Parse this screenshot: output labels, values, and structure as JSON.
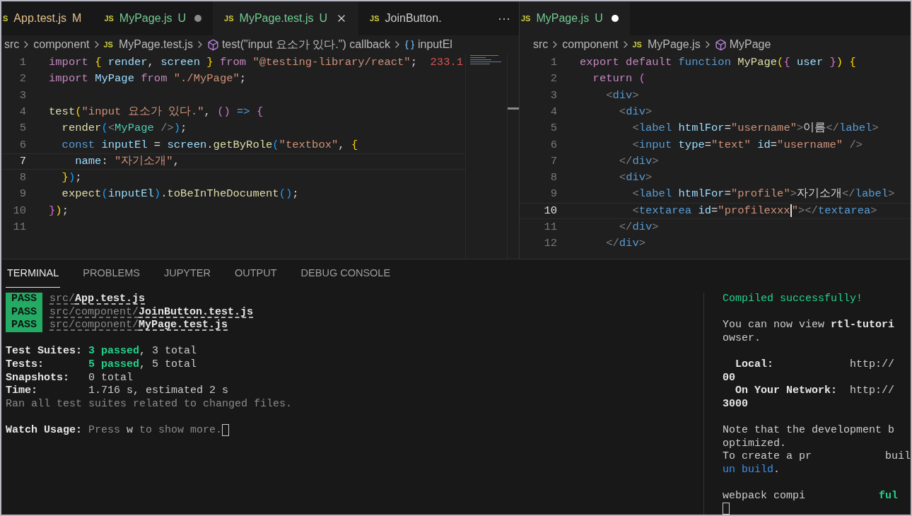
{
  "left_editor": {
    "tabs": [
      {
        "icon": "S",
        "label": "App.test.js",
        "status": "M",
        "kind": "modified",
        "dirty": false,
        "selected": false
      },
      {
        "icon": "JS",
        "label": "MyPage.js",
        "status": "U",
        "kind": "untracked",
        "dirty": true,
        "selected": false
      },
      {
        "icon": "JS",
        "label": "MyPage.test.js",
        "status": "U",
        "kind": "untracked",
        "dirty": false,
        "selected": true
      },
      {
        "icon": "JS",
        "label": "JoinButton.",
        "kind": "plain",
        "dirty": false,
        "selected": false
      }
    ],
    "more": "···",
    "breadcrumb": [
      {
        "kind": "folder",
        "text": "src"
      },
      {
        "kind": "folder",
        "text": "component"
      },
      {
        "kind": "file",
        "icon": "JS",
        "text": "MyPage.test.js"
      },
      {
        "kind": "function",
        "text": "test(\"input 요소가 있다.\") callback"
      },
      {
        "kind": "variable",
        "text": "inputEl"
      }
    ],
    "lines": [
      {
        "number": "1",
        "current": false,
        "tokens": [
          {
            "kind": "keyword",
            "text": "import "
          },
          {
            "kind": "brace1",
            "text": "{ "
          },
          {
            "kind": "variable",
            "text": "render"
          },
          {
            "kind": "punct",
            "text": ", "
          },
          {
            "kind": "variable",
            "text": "screen "
          },
          {
            "kind": "brace1",
            "text": "} "
          },
          {
            "kind": "keyword",
            "text": "from "
          },
          {
            "kind": "string",
            "text": "\"@testing-library/react\""
          },
          {
            "kind": "punct",
            "text": ";  "
          },
          {
            "kind": "hint",
            "text": "233.1"
          }
        ]
      },
      {
        "number": "2",
        "current": false,
        "tokens": [
          {
            "kind": "keyword",
            "text": "import "
          },
          {
            "kind": "variable",
            "text": "MyPage "
          },
          {
            "kind": "keyword",
            "text": "from "
          },
          {
            "kind": "string",
            "text": "\"./MyPage\""
          },
          {
            "kind": "punct",
            "text": ";"
          }
        ]
      },
      {
        "number": "3",
        "current": false
      },
      {
        "number": "4",
        "current": false,
        "tokens": [
          {
            "kind": "function",
            "text": "test"
          },
          {
            "kind": "brace1",
            "text": "("
          },
          {
            "kind": "string",
            "text": "\"input 요소가 있다.\""
          },
          {
            "kind": "punct",
            "text": ", "
          },
          {
            "kind": "brace2",
            "text": "() "
          },
          {
            "kind": "storage",
            "text": "=> "
          },
          {
            "kind": "brace2",
            "text": "{"
          }
        ]
      },
      {
        "number": "5",
        "current": false,
        "tokens": [
          {
            "kind": "function",
            "text": "  render"
          },
          {
            "kind": "brace3",
            "text": "("
          },
          {
            "kind": "tag-bracket",
            "text": "<"
          },
          {
            "kind": "component",
            "text": "MyPage"
          },
          {
            "kind": "tag-bracket",
            "text": " />"
          },
          {
            "kind": "brace3",
            "text": ")"
          },
          {
            "kind": "punct",
            "text": ";"
          }
        ]
      },
      {
        "number": "6",
        "current": false,
        "tokens": [
          {
            "kind": "storage",
            "text": "  const "
          },
          {
            "kind": "variable",
            "text": "inputEl"
          },
          {
            "kind": "punct",
            "text": " = "
          },
          {
            "kind": "variable",
            "text": "screen"
          },
          {
            "kind": "punct",
            "text": "."
          },
          {
            "kind": "function",
            "text": "getByRole"
          },
          {
            "kind": "brace3",
            "text": "("
          },
          {
            "kind": "string",
            "text": "\"textbox\""
          },
          {
            "kind": "punct",
            "text": ", "
          },
          {
            "kind": "brace1",
            "text": "{"
          }
        ]
      },
      {
        "number": "7",
        "current": true,
        "tokens": [
          {
            "kind": "variable",
            "text": "    name"
          },
          {
            "kind": "punct",
            "text": ": "
          },
          {
            "kind": "string",
            "text": "\"자기소개\""
          },
          {
            "kind": "punct",
            "text": ","
          }
        ]
      },
      {
        "number": "8",
        "current": false,
        "tokens": [
          {
            "kind": "brace1",
            "text": "  }"
          },
          {
            "kind": "brace3",
            "text": ")"
          },
          {
            "kind": "punct",
            "text": ";"
          }
        ]
      },
      {
        "number": "9",
        "current": false,
        "tokens": [
          {
            "kind": "function",
            "text": "  expect"
          },
          {
            "kind": "brace3",
            "text": "("
          },
          {
            "kind": "variable",
            "text": "inputEl"
          },
          {
            "kind": "brace3",
            "text": ")"
          },
          {
            "kind": "punct",
            "text": "."
          },
          {
            "kind": "function",
            "text": "toBeInTheDocument"
          },
          {
            "kind": "brace3",
            "text": "()"
          },
          {
            "kind": "punct",
            "text": ";"
          }
        ]
      },
      {
        "number": "10",
        "current": false,
        "tokens": [
          {
            "kind": "brace2",
            "text": "}"
          },
          {
            "kind": "brace1",
            "text": ")"
          },
          {
            "kind": "punct",
            "text": ";"
          }
        ]
      },
      {
        "number": "11",
        "current": false
      }
    ]
  },
  "right_editor": {
    "tabs": [
      {
        "icon": "JS",
        "label": "MyPage.js",
        "status": "U",
        "kind": "untracked",
        "dirty": true,
        "selected": true
      }
    ],
    "breadcrumb": [
      {
        "kind": "folder",
        "text": "src"
      },
      {
        "kind": "folder",
        "text": "component"
      },
      {
        "kind": "file",
        "icon": "JS",
        "text": "MyPage.js"
      },
      {
        "kind": "function",
        "text": "MyPage"
      }
    ],
    "lines": [
      {
        "number": "1",
        "current": false,
        "tokens": [
          {
            "kind": "keyword",
            "text": "export default "
          },
          {
            "kind": "storage",
            "text": "function "
          },
          {
            "kind": "function",
            "text": "MyPage"
          },
          {
            "kind": "brace1",
            "text": "("
          },
          {
            "kind": "brace2",
            "text": "{"
          },
          {
            "kind": "variable",
            "text": " user "
          },
          {
            "kind": "brace2",
            "text": "}"
          },
          {
            "kind": "brace1",
            "text": ") "
          },
          {
            "kind": "brace1",
            "text": "{"
          }
        ]
      },
      {
        "number": "2",
        "current": false,
        "tokens": [
          {
            "kind": "keyword",
            "text": "  return "
          },
          {
            "kind": "brace2",
            "text": "("
          }
        ]
      },
      {
        "number": "3",
        "current": false,
        "tokens": [
          {
            "kind": "tag-bracket",
            "text": "    <"
          },
          {
            "kind": "tag",
            "text": "div"
          },
          {
            "kind": "tag-bracket",
            "text": ">"
          }
        ]
      },
      {
        "number": "4",
        "current": false,
        "tokens": [
          {
            "kind": "tag-bracket",
            "text": "      <"
          },
          {
            "kind": "tag",
            "text": "div"
          },
          {
            "kind": "tag-bracket",
            "text": ">"
          }
        ]
      },
      {
        "number": "5",
        "current": false,
        "tokens": [
          {
            "kind": "tag-bracket",
            "text": "        <"
          },
          {
            "kind": "tag",
            "text": "label "
          },
          {
            "kind": "variable",
            "text": "htmlFor"
          },
          {
            "kind": "punct",
            "text": "="
          },
          {
            "kind": "string",
            "text": "\"username\""
          },
          {
            "kind": "tag-bracket",
            "text": ">"
          },
          {
            "kind": "punct",
            "text": "이름"
          },
          {
            "kind": "tag-bracket",
            "text": "</"
          },
          {
            "kind": "tag",
            "text": "label"
          },
          {
            "kind": "tag-bracket",
            "text": ">"
          }
        ]
      },
      {
        "number": "6",
        "current": false,
        "tokens": [
          {
            "kind": "tag-bracket",
            "text": "        <"
          },
          {
            "kind": "tag",
            "text": "input "
          },
          {
            "kind": "variable",
            "text": "type"
          },
          {
            "kind": "punct",
            "text": "="
          },
          {
            "kind": "string",
            "text": "\"text\" "
          },
          {
            "kind": "variable",
            "text": "id"
          },
          {
            "kind": "punct",
            "text": "="
          },
          {
            "kind": "string",
            "text": "\"username\""
          },
          {
            "kind": "tag-bracket",
            "text": " />"
          }
        ]
      },
      {
        "number": "7",
        "current": false,
        "tokens": [
          {
            "kind": "tag-bracket",
            "text": "      </"
          },
          {
            "kind": "tag",
            "text": "div"
          },
          {
            "kind": "tag-bracket",
            "text": ">"
          }
        ]
      },
      {
        "number": "8",
        "current": false,
        "tokens": [
          {
            "kind": "tag-bracket",
            "text": "      <"
          },
          {
            "kind": "tag",
            "text": "div"
          },
          {
            "kind": "tag-bracket",
            "text": ">"
          }
        ]
      },
      {
        "number": "9",
        "current": false,
        "tokens": [
          {
            "kind": "tag-bracket",
            "text": "        <"
          },
          {
            "kind": "tag",
            "text": "label "
          },
          {
            "kind": "variable",
            "text": "htmlFor"
          },
          {
            "kind": "punct",
            "text": "="
          },
          {
            "kind": "string",
            "text": "\"profile\""
          },
          {
            "kind": "tag-bracket",
            "text": ">"
          },
          {
            "kind": "punct",
            "text": "자기소개"
          },
          {
            "kind": "tag-bracket",
            "text": "</"
          },
          {
            "kind": "tag",
            "text": "label"
          },
          {
            "kind": "tag-bracket",
            "text": ">"
          }
        ]
      },
      {
        "number": "10",
        "current": true,
        "tokens": [
          {
            "kind": "tag-bracket",
            "text": "        <"
          },
          {
            "kind": "tag",
            "text": "textarea "
          },
          {
            "kind": "variable",
            "text": "id"
          },
          {
            "kind": "punct",
            "text": "="
          },
          {
            "kind": "string",
            "text": "\"profilexxx"
          },
          {
            "kind": "cursor"
          },
          {
            "kind": "string",
            "text": "\""
          },
          {
            "kind": "tag-bracket",
            "text": "></"
          },
          {
            "kind": "tag",
            "text": "textarea"
          },
          {
            "kind": "tag-bracket",
            "text": ">"
          }
        ]
      },
      {
        "number": "11",
        "current": false,
        "tokens": [
          {
            "kind": "tag-bracket",
            "text": "      </"
          },
          {
            "kind": "tag",
            "text": "div"
          },
          {
            "kind": "tag-bracket",
            "text": ">"
          }
        ]
      },
      {
        "number": "12",
        "current": false,
        "tokens": [
          {
            "kind": "tag-bracket",
            "text": "    </"
          },
          {
            "kind": "tag",
            "text": "div"
          },
          {
            "kind": "tag-bracket",
            "text": ">"
          }
        ]
      }
    ]
  },
  "panel": {
    "tabs": [
      {
        "label": "TERMINAL",
        "selected": true
      },
      {
        "label": "PROBLEMS",
        "selected": false
      },
      {
        "label": "JUPYTER",
        "selected": false
      },
      {
        "label": "OUTPUT",
        "selected": false
      },
      {
        "label": "DEBUG CONSOLE",
        "selected": false
      }
    ],
    "test_terminal": [
      {
        "kind": "text",
        "segments": [
          {
            "kind": "badge",
            "text": "PASS"
          },
          {
            "kind": "dim-path",
            "text": "src/"
          },
          {
            "kind": "bold-path",
            "text": "App.test.js"
          }
        ]
      },
      {
        "kind": "text",
        "segments": [
          {
            "kind": "badge",
            "text": "PASS"
          },
          {
            "kind": "dim-path",
            "text": "src/component/"
          },
          {
            "kind": "bold-path",
            "text": "JoinButton.test.js"
          }
        ]
      },
      {
        "kind": "text",
        "segments": [
          {
            "kind": "badge",
            "text": "PASS"
          },
          {
            "kind": "dim-path",
            "text": "src/component/"
          },
          {
            "kind": "bold-path",
            "text": "MyPage.test.js"
          }
        ]
      },
      {
        "kind": "blank"
      },
      {
        "kind": "text",
        "segments": [
          {
            "kind": "bold",
            "text": "Test Suites: "
          },
          {
            "kind": "success",
            "text": "3 passed"
          },
          {
            "kind": "plain",
            "text": ", 3 total"
          }
        ]
      },
      {
        "kind": "text",
        "segments": [
          {
            "kind": "bold",
            "text": "Tests:       "
          },
          {
            "kind": "success",
            "text": "5 passed"
          },
          {
            "kind": "plain",
            "text": ", 5 total"
          }
        ]
      },
      {
        "kind": "text",
        "segments": [
          {
            "kind": "bold",
            "text": "Snapshots:   "
          },
          {
            "kind": "plain",
            "text": "0 total"
          }
        ]
      },
      {
        "kind": "text",
        "segments": [
          {
            "kind": "bold",
            "text": "Time:        "
          },
          {
            "kind": "plain",
            "text": "1.716 s, estimated 2 s"
          }
        ]
      },
      {
        "kind": "text",
        "segments": [
          {
            "kind": "dim",
            "text": "Ran all test suites related to changed files."
          }
        ]
      },
      {
        "kind": "blank"
      },
      {
        "kind": "text",
        "segments": [
          {
            "kind": "bold",
            "text": "Watch Usage: "
          },
          {
            "kind": "dim",
            "text": "Press "
          },
          {
            "kind": "plain",
            "text": "w"
          },
          {
            "kind": "dim",
            "text": " to show more."
          },
          {
            "kind": "cursor"
          }
        ]
      }
    ],
    "server_terminal": [
      {
        "kind": "text",
        "segments": [
          {
            "kind": "message",
            "text": "Compiled successfully!"
          }
        ]
      },
      {
        "kind": "blank"
      },
      {
        "kind": "text",
        "segments": [
          {
            "kind": "plain",
            "text": "You can now view "
          },
          {
            "kind": "bold",
            "text": "rtl-tutori"
          }
        ]
      },
      {
        "kind": "text",
        "segments": [
          {
            "kind": "plain",
            "text": "owser."
          }
        ]
      },
      {
        "kind": "blank"
      },
      {
        "kind": "text",
        "segments": [
          {
            "kind": "bold",
            "text": "  Local:"
          },
          {
            "kind": "plain",
            "text": "            http://"
          }
        ]
      },
      {
        "kind": "text",
        "segments": [
          {
            "kind": "bold",
            "text": "00"
          }
        ]
      },
      {
        "kind": "text",
        "segments": [
          {
            "kind": "bold",
            "text": "  On Your Network:"
          },
          {
            "kind": "plain",
            "text": "  http://"
          }
        ]
      },
      {
        "kind": "text",
        "segments": [
          {
            "kind": "bold",
            "text": "3000"
          }
        ]
      },
      {
        "kind": "blank"
      },
      {
        "kind": "text",
        "segments": [
          {
            "kind": "plain",
            "text": "Note that the development b"
          }
        ]
      },
      {
        "kind": "text",
        "segments": [
          {
            "kind": "plain",
            "text": "optimized."
          }
        ]
      },
      {
        "kind": "text",
        "segments": [
          {
            "kind": "plain",
            "text": "To create a pr"
          },
          {
            "kind": "gap"
          },
          {
            "kind": "plain",
            "text": "buil"
          }
        ]
      },
      {
        "kind": "text",
        "segments": [
          {
            "kind": "link",
            "text": "un build"
          },
          {
            "kind": "plain",
            "text": "."
          }
        ]
      },
      {
        "kind": "blank"
      },
      {
        "kind": "text",
        "segments": [
          {
            "kind": "plain",
            "text": "webpack compi"
          },
          {
            "kind": "gap"
          },
          {
            "kind": "success",
            "text": "ful"
          }
        ]
      },
      {
        "kind": "text",
        "segments": [
          {
            "kind": "cursor"
          }
        ]
      }
    ]
  }
}
